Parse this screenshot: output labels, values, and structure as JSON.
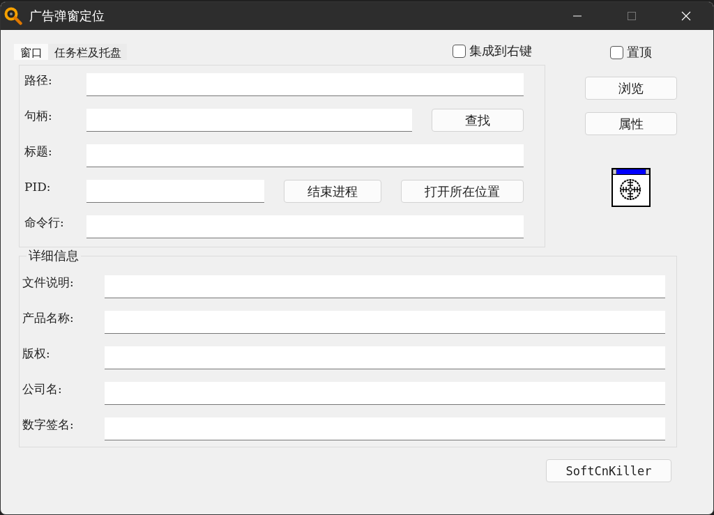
{
  "window": {
    "title": "广告弹窗定位"
  },
  "tabs": [
    {
      "label": "窗口",
      "selected": true
    },
    {
      "label": "任务栏及托盘",
      "selected": false
    }
  ],
  "options": [
    {
      "label": "集成到右键",
      "checked": false
    },
    {
      "label": "置顶",
      "checked": false
    }
  ],
  "window_info": {
    "fields": [
      {
        "label": "路径:"
      },
      {
        "label": "句柄:",
        "buttons": [
          "查找"
        ]
      },
      {
        "label": "标题:"
      },
      {
        "label": "PID:",
        "buttons": [
          "结束进程",
          "打开所在位置"
        ]
      },
      {
        "label": "命令行:"
      }
    ]
  },
  "side_buttons": [
    "浏览",
    "属性"
  ],
  "details": {
    "title": "详细信息",
    "fields": [
      {
        "label": "文件说明:"
      },
      {
        "label": "产品名称:"
      },
      {
        "label": "版权:"
      },
      {
        "label": "公司名:"
      },
      {
        "label": "数字签名:"
      }
    ]
  },
  "footer_button": "SoftCnKiller"
}
